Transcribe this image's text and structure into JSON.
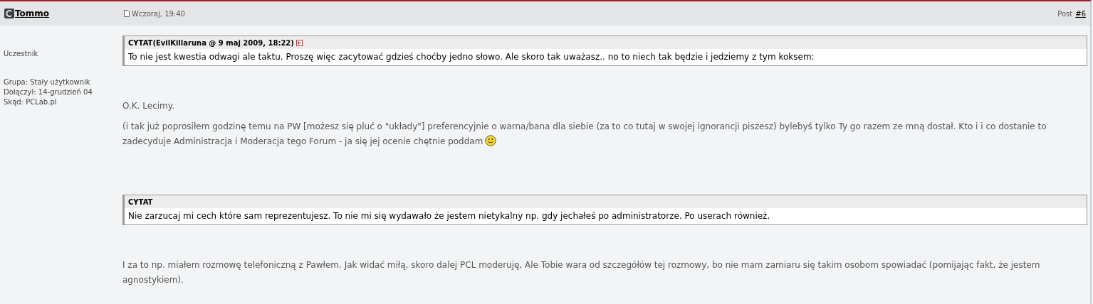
{
  "post": {
    "author": "Tommo",
    "date": "Wczoraj, 19:40",
    "post_label": "Post",
    "post_number": "#6"
  },
  "profile": {
    "rank": "Uczestnik",
    "details": [
      "Grupa: Stały użytkownik",
      "Dołączył: 14-grudzień 04",
      "Skąd: PCLab.pl"
    ]
  },
  "blocks": [
    {
      "kind": "quote",
      "header": "CYTAT(EvilKillaruna @ 9 maj 2009, 18:22)",
      "has_link": true,
      "text": "To nie jest kwestia odwagi ale taktu. Proszę więc zacytować gdzieś choćby jedno słowo. Ale skoro tak uważasz.. no to niech tak będzie i jedziemy z tym koksem:"
    },
    {
      "kind": "text",
      "text": "O.K. Lecimy.",
      "smiley": false
    },
    {
      "kind": "text",
      "text": "(i tak już poprosiłem godzinę temu na PW [możesz się pluć o \"układy\"] preferencyjnie o warna/bana dla siebie (za to co tutaj w swojej ignorancji piszesz) bylebyś tylko Ty go razem ze mną dostał. Kto i i co dostanie to zadecyduje Administracja i Moderacja tego Forum - ja się jej ocenie chętnie poddam",
      "smiley": true
    },
    {
      "kind": "quote",
      "header": "CYTAT",
      "has_link": false,
      "text": "Nie zarzucaj mi cech które sam reprezentujesz. To nie mi się wydawało że jestem nietykalny np. gdy jechałeś po administratorze. Po userach również."
    },
    {
      "kind": "text",
      "text": "I za to np. miałem rozmowę telefoniczną z Pawłem. Jak widać miłą, skoro dalej PCL moderuję, Ale Tobie wara od szczegółów tej rozmowy, bo nie mam zamiaru się takim osobom spowiadać (pomijając fakt, że jestem agnostykiem).",
      "smiley": false
    }
  ]
}
